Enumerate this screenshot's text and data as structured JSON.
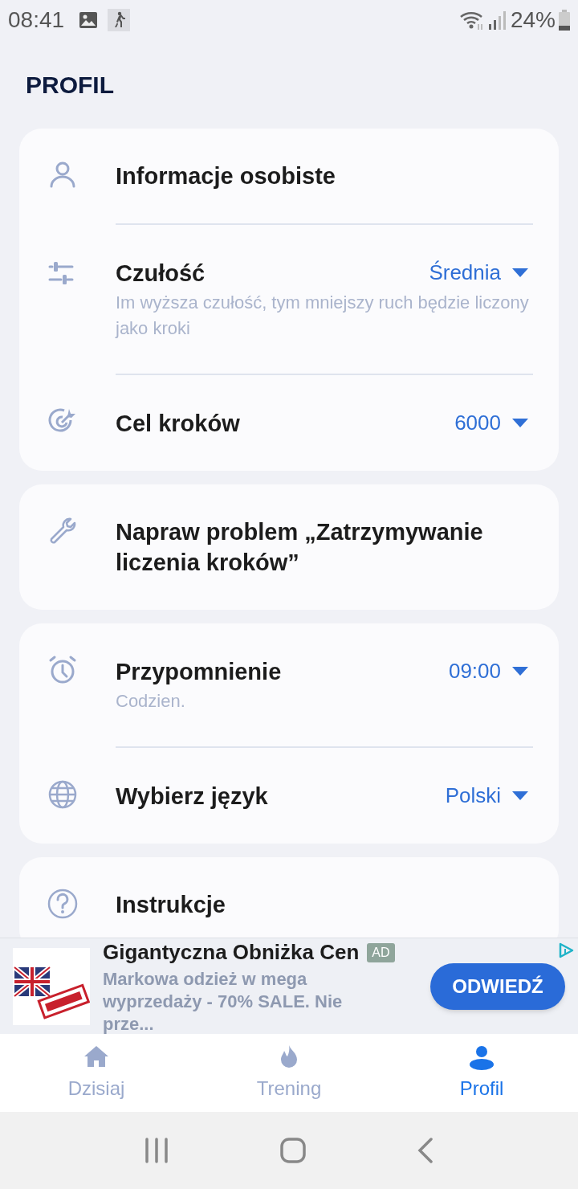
{
  "status_bar": {
    "time": "08:41",
    "battery": "24%"
  },
  "title": "PROFIL",
  "sections": [
    {
      "items": [
        {
          "label": "Informacje osobiste"
        },
        {
          "label": "Czułość",
          "subtitle": "Im wyższa czułość, tym mniejszy ruch będzie liczony jako kroki",
          "value": "Średnia"
        },
        {
          "label": "Cel kroków",
          "value": "6000"
        }
      ]
    },
    {
      "items": [
        {
          "label": "Napraw problem „Zatrzymywanie liczenia kroków”"
        }
      ]
    },
    {
      "items": [
        {
          "label": "Przypomnienie",
          "subtitle": "Codzien.",
          "value": "09:00"
        },
        {
          "label": "Wybierz język",
          "value": "Polski"
        }
      ]
    },
    {
      "items": [
        {
          "label": "Instrukcje"
        }
      ]
    }
  ],
  "ad": {
    "title": "Gigantyczna Obniżka Cen",
    "badge": "AD",
    "text": "Markowa odzież w mega wyprzedaży - 70% SALE. Nie prze...",
    "button": "ODWIEDŹ"
  },
  "bottom_nav": [
    {
      "label": "Dzisiaj",
      "selected": false
    },
    {
      "label": "Trening",
      "selected": false
    },
    {
      "label": "Profil",
      "selected": true
    }
  ]
}
